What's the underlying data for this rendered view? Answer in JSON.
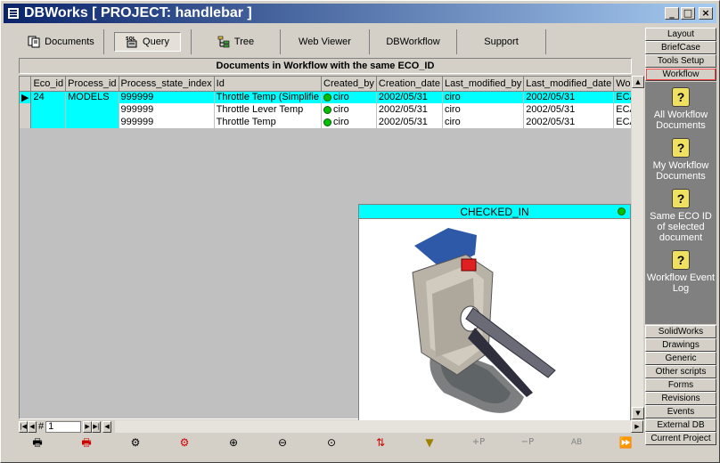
{
  "window": {
    "title": "DBWorks [ PROJECT: handlebar ]",
    "buttons": {
      "minimize": "_",
      "maximize": "□",
      "close": "×"
    }
  },
  "tabs": [
    {
      "label": "Documents",
      "icon": "documents-icon"
    },
    {
      "label": "Query",
      "icon": "sql-query-icon",
      "icon_text": "SQL"
    },
    {
      "label": "Tree",
      "icon": "tree-icon"
    },
    {
      "label": "Web Viewer"
    },
    {
      "label": "DBWorkflow"
    },
    {
      "label": "Support"
    }
  ],
  "section_title": "Documents in Workflow with the same ECO_ID",
  "table": {
    "columns": [
      "Eco_id",
      "Process_id",
      "Process_state_index",
      "Id",
      "Created_by",
      "Creation_date",
      "Last_modified_by",
      "Last_modified_date",
      "Workflow_state"
    ],
    "rows": [
      {
        "eco_id": "24",
        "process_id": "MODELS",
        "state_index": "999999",
        "id": "Throttle Temp (Simplifie",
        "created_by": "ciro",
        "creation_date": "2002/05/31",
        "last_modified_by": "ciro",
        "last_modified_date": "2002/05/31",
        "workflow_state": "ECA_OK"
      },
      {
        "eco_id": "",
        "process_id": "",
        "state_index": "999999",
        "id": "Throttle Lever Temp",
        "created_by": "ciro",
        "creation_date": "2002/05/31",
        "last_modified_by": "ciro",
        "last_modified_date": "2002/05/31",
        "workflow_state": "ECA_OK"
      },
      {
        "eco_id": "",
        "process_id": "",
        "state_index": "999999",
        "id": "Throttle Temp",
        "created_by": "ciro",
        "creation_date": "2002/05/31",
        "last_modified_by": "ciro",
        "last_modified_date": "2002/05/31",
        "workflow_state": "ECA_OK"
      }
    ]
  },
  "preview": {
    "status": "CHECKED_IN"
  },
  "navigator": {
    "label": "#",
    "record": "1"
  },
  "toolbar_icons": [
    "print-icon",
    "print-all-icon",
    "gear-icon",
    "gear-all-icon",
    "zoom-in-icon",
    "zoom-out-icon",
    "zoom-fit-icon",
    "sort-icon",
    "filter-icon",
    "add-p-icon",
    "remove-p-icon",
    "translate-icon",
    "forward-icon"
  ],
  "toolbar_glyphs": {
    "add_p": "+P",
    "remove_p": "−P",
    "translate": "AB"
  },
  "right_panel": {
    "top_buttons": [
      "Layout",
      "BriefCase",
      "Tools Setup",
      "Workflow"
    ],
    "selected": "Workflow",
    "workflow_items": [
      {
        "label": "All Workflow Documents"
      },
      {
        "label": "My Workflow Documents"
      },
      {
        "label": "Same ECO ID of selected document"
      },
      {
        "label": "Workflow Event Log"
      }
    ],
    "bottom_buttons": [
      "SolidWorks",
      "Drawings",
      "Generic",
      "Other scripts",
      "Forms",
      "Revisions",
      "Events",
      "External DB",
      "Current Project"
    ]
  }
}
